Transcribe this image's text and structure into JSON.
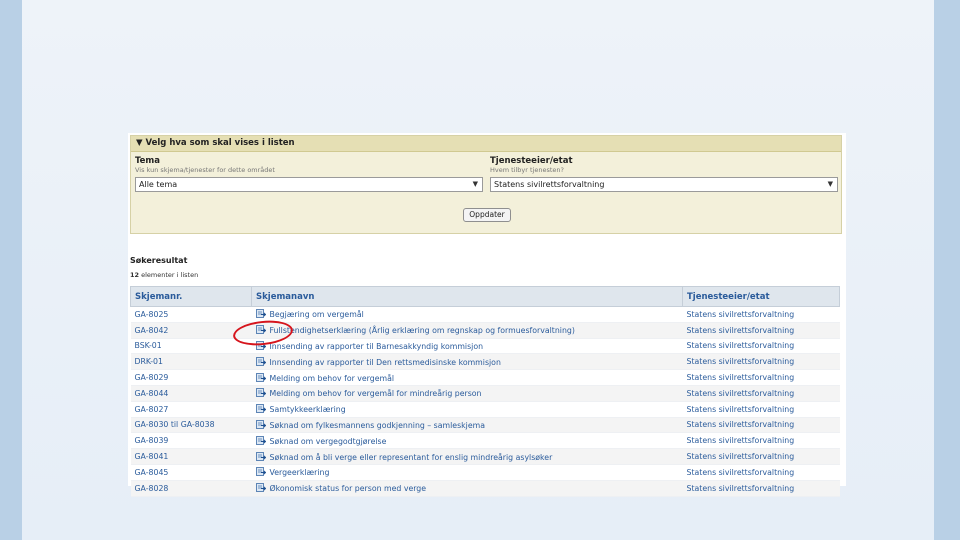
{
  "filter": {
    "header": "▼ Velg hva som skal vises i listen",
    "tema_label": "Tema",
    "tema_hint": "Vis kun skjema/tjenester for dette området",
    "tema_value": "Alle tema",
    "eier_label": "Tjenesteeier/etat",
    "eier_hint": "Hvem tilbyr tjenesten?",
    "eier_value": "Statens sivilrettsforvaltning",
    "update_label": "Oppdater"
  },
  "results": {
    "title": "Søkeresultat",
    "count_num": "12",
    "count_text": " elementer i listen",
    "columns": [
      "Skjemanr.",
      "Skjemanavn",
      "Tjenesteeier/etat"
    ],
    "rows": [
      {
        "nr": "GA-8025",
        "name": "Begjæring om vergemål",
        "owner": "Statens sivilrettsforvaltning"
      },
      {
        "nr": "GA-8042",
        "name": "Fullstendighetserklæring (Årlig erklæring om regnskap og formuesforvaltning)",
        "owner": "Statens sivilrettsforvaltning"
      },
      {
        "nr": "BSK-01",
        "name": "Innsending av rapporter til Barnesakkyndig kommisjon",
        "owner": "Statens sivilrettsforvaltning"
      },
      {
        "nr": "DRK-01",
        "name": "Innsending av rapporter til Den rettsmedisinske kommisjon",
        "owner": "Statens sivilrettsforvaltning"
      },
      {
        "nr": "GA-8029",
        "name": "Melding om behov for vergemål",
        "owner": "Statens sivilrettsforvaltning"
      },
      {
        "nr": "GA-8044",
        "name": "Melding om behov for vergemål for mindreårig person",
        "owner": "Statens sivilrettsforvaltning"
      },
      {
        "nr": "GA-8027",
        "name": "Samtykkeerklæring",
        "owner": "Statens sivilrettsforvaltning"
      },
      {
        "nr": "GA-8030 til GA-8038",
        "name": "Søknad om fylkesmannens godkjenning – samleskjema",
        "owner": "Statens sivilrettsforvaltning"
      },
      {
        "nr": "GA-8039",
        "name": "Søknad om vergegodtgjørelse",
        "owner": "Statens sivilrettsforvaltning"
      },
      {
        "nr": "GA-8041",
        "name": "Søknad om å bli verge eller representant for enslig mindreårig asylsøker",
        "owner": "Statens sivilrettsforvaltning"
      },
      {
        "nr": "GA-8045",
        "name": "Vergeerklæring",
        "owner": "Statens sivilrettsforvaltning"
      },
      {
        "nr": "GA-8028",
        "name": "Økonomisk status for person med verge",
        "owner": "Statens sivilrettsforvaltning"
      }
    ]
  },
  "colors": {
    "link": "#2a5b9b",
    "filter_bg": "#f3f0da",
    "annotation": "#d6141c"
  }
}
